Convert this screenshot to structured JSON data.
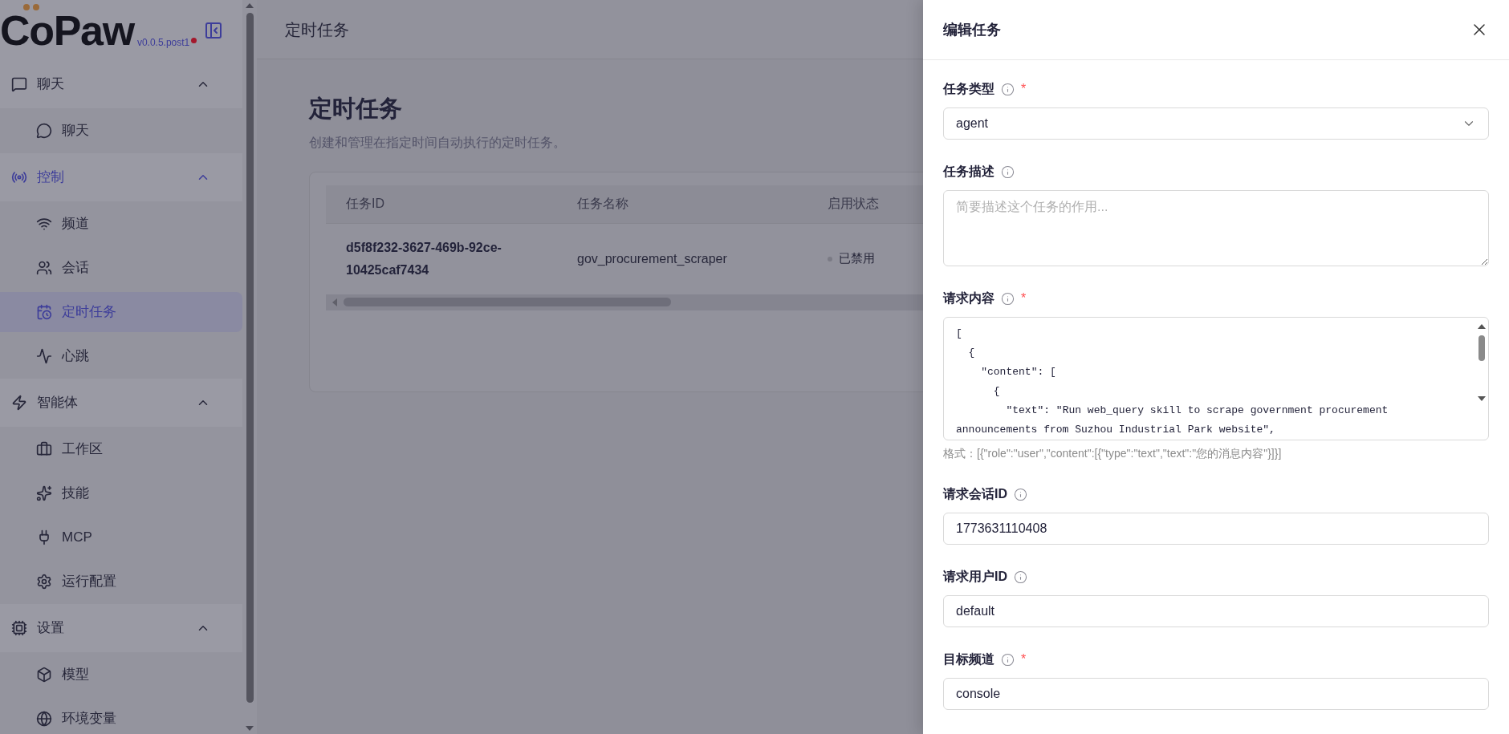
{
  "brand": {
    "name": "CoPaw",
    "version": "v0.0.5.post1"
  },
  "sidebar": {
    "groups": [
      {
        "label": "聊天",
        "expanded": true,
        "selected": false,
        "children": [
          {
            "label": "聊天",
            "selected": false
          }
        ]
      },
      {
        "label": "控制",
        "expanded": true,
        "selected": true,
        "children": [
          {
            "label": "频道",
            "selected": false
          },
          {
            "label": "会话",
            "selected": false
          },
          {
            "label": "定时任务",
            "selected": true
          },
          {
            "label": "心跳",
            "selected": false
          }
        ]
      },
      {
        "label": "智能体",
        "expanded": true,
        "selected": false,
        "children": [
          {
            "label": "工作区",
            "selected": false
          },
          {
            "label": "技能",
            "selected": false
          },
          {
            "label": "MCP",
            "selected": false
          },
          {
            "label": "运行配置",
            "selected": false
          }
        ]
      },
      {
        "label": "设置",
        "expanded": true,
        "selected": false,
        "children": [
          {
            "label": "模型",
            "selected": false
          },
          {
            "label": "环境变量",
            "selected": false
          }
        ]
      }
    ]
  },
  "header": {
    "title": "定时任务"
  },
  "page": {
    "title": "定时任务",
    "description": "创建和管理在指定时间自动执行的定时任务。"
  },
  "table": {
    "columns": [
      "任务ID",
      "任务名称",
      "启用状态"
    ],
    "rows": [
      {
        "id": "d5f8f232-3627-469b-92ce-10425caf7434",
        "name": "gov_procurement_scraper",
        "status": "已禁用",
        "enabled": false
      }
    ]
  },
  "drawer": {
    "title": "编辑任务",
    "required_mark": "*",
    "fields": [
      {
        "kind": "select",
        "label": "任务类型",
        "required": true,
        "value": "agent"
      },
      {
        "kind": "textarea",
        "label": "任务描述",
        "required": false,
        "placeholder": "简要描述这个任务的作用..."
      },
      {
        "kind": "code",
        "label": "请求内容",
        "required": true,
        "lines": [
          "[",
          "  {",
          "    \"content\": [",
          "      {",
          "        \"text\": \"Run web_query skill to scrape government procurement announcements from Suzhou Industrial Park website\","
        ],
        "hint": "格式：[{\"role\":\"user\",\"content\":[{\"type\":\"text\",\"text\":\"您的消息内容\"}]}]"
      },
      {
        "kind": "input",
        "label": "请求会话ID",
        "required": false,
        "value": "1773631110408"
      },
      {
        "kind": "input",
        "label": "请求用户ID",
        "required": false,
        "value": "default"
      },
      {
        "kind": "input",
        "label": "目标频道",
        "required": true,
        "value": "console"
      }
    ]
  }
}
